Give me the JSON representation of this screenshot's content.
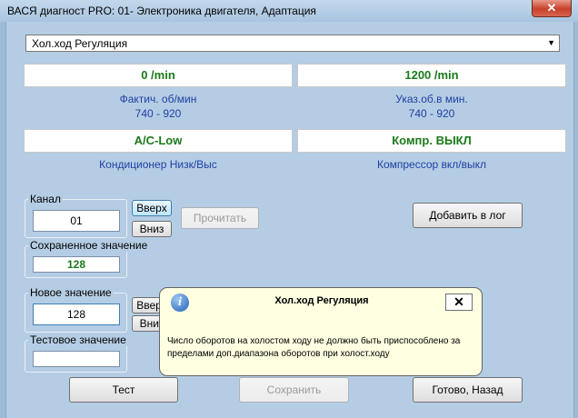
{
  "window": {
    "title": "ВАСЯ диагност PRO: 01- Электроника двигателя, Адаптация",
    "close_glyph": "✕"
  },
  "dropdown": {
    "value": "Хол.ход Регуляция",
    "arrow_icon": "chevron-down-icon",
    "arrow_glyph": "▼"
  },
  "readouts": [
    {
      "value": "0 /min",
      "label_line1": "Фактич. об/мин",
      "label_line2": "740 - 920"
    },
    {
      "value": "1200 /min",
      "label_line1": "Указ.об.в мин.",
      "label_line2": "740 - 920"
    },
    {
      "value": "A/C-Low",
      "label_line1": "Кондиционер Низк/Выс"
    },
    {
      "value": "Компр. ВЫКЛ",
      "label_line1": "Компрессор вкл/выкл"
    }
  ],
  "channel": {
    "label": "Канал",
    "value": "01",
    "up": "Вверх",
    "down": "Вниз",
    "read": "Прочитать"
  },
  "saved": {
    "label": "Сохраненное значение",
    "value": "128"
  },
  "new_value": {
    "label": "Новое значение",
    "value": "128",
    "up": "Вверх",
    "down": "Вниз"
  },
  "test_value": {
    "label": "Тестовое значение",
    "value": ""
  },
  "buttons": {
    "log": "Добавить в лог",
    "test": "Тест",
    "save": "Сохранить",
    "done": "Готово, Назад"
  },
  "tooltip": {
    "title": "Хол.ход Регуляция",
    "close_glyph": "✕",
    "message": "Число оборотов на холостом ходу не должно быть приспособлено за пределами доп.диапазона оборотов при холост.ходу"
  },
  "colors": {
    "value_green": "#1a7a1a",
    "label_blue": "#1f3fa3",
    "background": "#b5cde4"
  }
}
